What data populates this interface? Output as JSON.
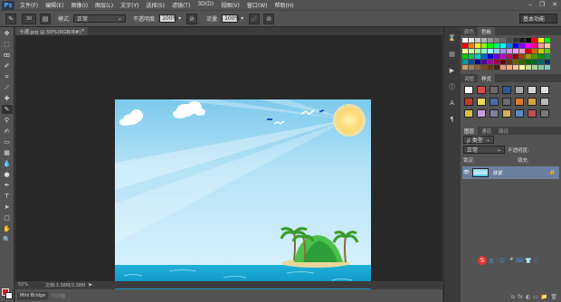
{
  "app": {
    "logo": "Ps"
  },
  "menu": [
    "文件(F)",
    "编辑(E)",
    "图像(I)",
    "图层(L)",
    "文字(Y)",
    "选择(S)",
    "滤镜(T)",
    "3D(D)",
    "视图(V)",
    "窗口(W)",
    "帮助(H)"
  ],
  "window_controls": {
    "minimize": "–",
    "restore": "❐",
    "close": "✕"
  },
  "options": {
    "brush_size": "30",
    "mode_label": "模式:",
    "mode_value": "正常",
    "opacity_label": "不透明度:",
    "opacity_value": "100%",
    "flow_label": "流量:",
    "flow_value": "100%",
    "workspace": "基本功能"
  },
  "document": {
    "tab_title": "卡通.jpg @ 50%(RGB/8#)",
    "close": "×"
  },
  "status": {
    "zoom": "50%",
    "doc_info": "文档:3.38M/3.38M",
    "arrow": "▶"
  },
  "bottom_tabs": {
    "mini_bridge": "Mini Bridge",
    "timeline": "时间轴"
  },
  "color_panel": {
    "tabs": [
      "颜色",
      "色板"
    ],
    "active": "色板"
  },
  "swatch_colors": [
    "#ffffff",
    "#e6e6e6",
    "#cccccc",
    "#b3b3b3",
    "#999999",
    "#808080",
    "#666666",
    "#4d4d4d",
    "#333333",
    "#1a1a1a",
    "#000000",
    "#ff0000",
    "#ffff00",
    "#00ff00",
    "#ff0000",
    "#ff7f00",
    "#ffff00",
    "#80ff00",
    "#00ff00",
    "#00ff80",
    "#00ffff",
    "#0080ff",
    "#0000ff",
    "#8000ff",
    "#ff00ff",
    "#ff0080",
    "#ff9999",
    "#ffcc99",
    "#ffff99",
    "#ccff99",
    "#99ff99",
    "#99ffcc",
    "#99ffff",
    "#99ccff",
    "#9999ff",
    "#cc99ff",
    "#ff99ff",
    "#ff99cc",
    "#cc0000",
    "#cc6600",
    "#cccc00",
    "#66cc00",
    "#00cc00",
    "#00cc66",
    "#00cccc",
    "#0066cc",
    "#0000cc",
    "#6600cc",
    "#cc00cc",
    "#cc0066",
    "#990000",
    "#994c00",
    "#999900",
    "#4c9900",
    "#009900",
    "#00994c",
    "#009999",
    "#004c99",
    "#000099",
    "#4c0099",
    "#990099",
    "#99004c",
    "#660000",
    "#663300",
    "#666600",
    "#336600",
    "#006600",
    "#006633",
    "#006666",
    "#003366",
    "#c69c6d",
    "#a67c52",
    "#8c6239",
    "#754c24",
    "#603913",
    "#3c2415",
    "#f7977a",
    "#fbad82",
    "#fdc68c",
    "#fff79a",
    "#c4df9b",
    "#a3d39c",
    "#82ca9d",
    "#7bcdc8"
  ],
  "adjust_panel": {
    "tabs": [
      "调整",
      "样式"
    ],
    "active": "样式"
  },
  "style_colors": [
    "#ffffff",
    "#d84c4c",
    "#6a6a6a",
    "#2a5a9a",
    "#aaaaaa",
    "#d8d8d8",
    "#e0e0e0",
    "#c43a2a",
    "#e8d85a",
    "#4a6aa8",
    "#6a6a6a",
    "#e07a28",
    "#d8a040",
    "#b8b8b8",
    "#d8c04a",
    "#c8a0e0",
    "#8080a0",
    "#d0b060",
    "#5a8ac8",
    "#c05050",
    "#7a7a7a"
  ],
  "layers_panel": {
    "tabs": [
      "图层",
      "通道",
      "路径"
    ],
    "active": "图层",
    "kind": "ρ 类型",
    "blend_mode": "正常",
    "opacity_label": "不透明度:",
    "lock_label": "锁定:",
    "fill_label": "填充:",
    "layer_name": "背景",
    "eye": "👁",
    "lock": "🔒"
  },
  "ime": {
    "logo": "S",
    "items": [
      "英",
      "·",
      "☺",
      "🎤",
      "⌨",
      "👕",
      "⁝⁝"
    ]
  },
  "panel_footer_icons": [
    "⊖",
    "fx",
    "◐",
    "▭",
    "📁",
    "🗑"
  ]
}
